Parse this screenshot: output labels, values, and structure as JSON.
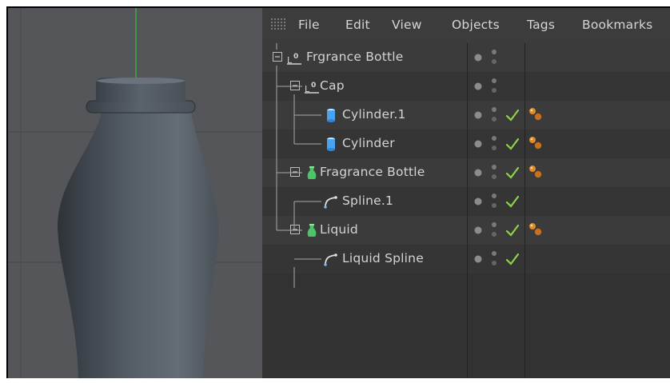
{
  "menu": [
    "File",
    "Edit",
    "View",
    "Objects",
    "Tags",
    "Bookmarks"
  ],
  "objects": [
    {
      "label": "Frgrance Bottle",
      "icon": "null-object-icon",
      "level": 0,
      "expand": true,
      "check": false,
      "tag": false
    },
    {
      "label": "Cap",
      "icon": "null-object-icon",
      "level": 1,
      "expand": true,
      "check": false,
      "tag": false
    },
    {
      "label": "Cylinder.1",
      "icon": "cylinder-icon",
      "level": 2,
      "expand": false,
      "check": true,
      "tag": true
    },
    {
      "label": "Cylinder",
      "icon": "cylinder-icon",
      "level": 2,
      "expand": false,
      "check": true,
      "tag": true
    },
    {
      "label": "Fragrance Bottle",
      "icon": "lathe-icon",
      "level": 1,
      "expand": true,
      "check": true,
      "tag": true
    },
    {
      "label": "Spline.1",
      "icon": "spline-icon",
      "level": 2,
      "expand": false,
      "check": true,
      "tag": false
    },
    {
      "label": "Liquid",
      "icon": "lathe-icon",
      "level": 1,
      "expand": true,
      "check": true,
      "tag": true
    },
    {
      "label": "Liquid Spline",
      "icon": "spline-icon",
      "level": 2,
      "expand": false,
      "check": true,
      "tag": false
    }
  ],
  "colors": {
    "viewport_bg": "#545659",
    "manager_bg": "#323232",
    "check_green": "#8fd14f",
    "tag_orange": "#e08a2c",
    "axis_green": "#3fbf3f"
  }
}
